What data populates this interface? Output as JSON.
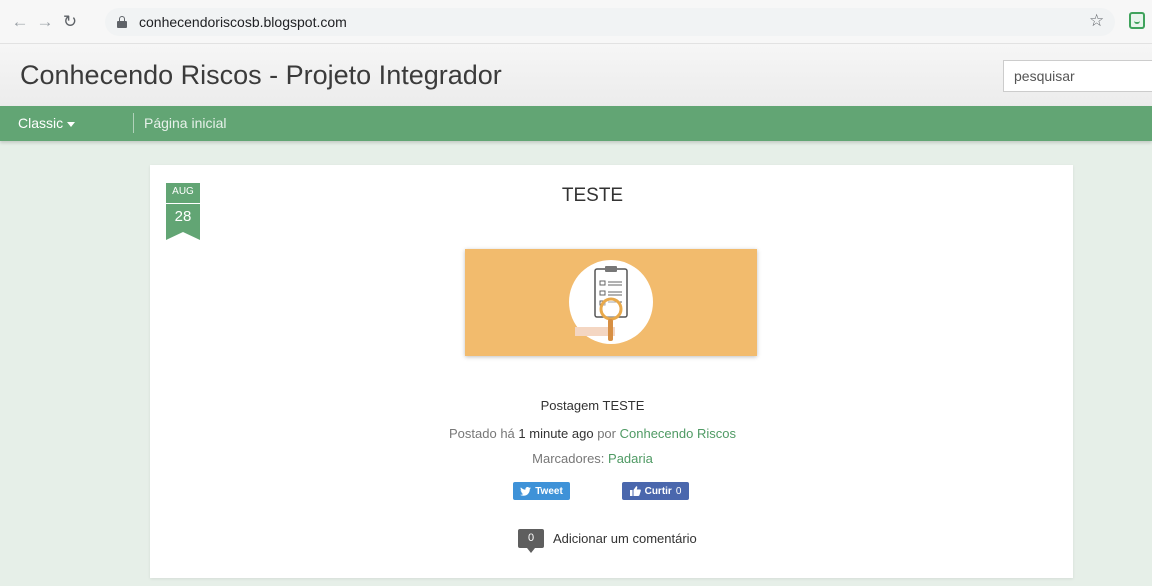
{
  "browser": {
    "url": "conhecendoriscosb.blogspot.com",
    "icons": {
      "back": "arrow-left-icon",
      "forward": "arrow-right-icon",
      "reload": "reload-icon",
      "lock": "lock-icon",
      "bookmark": "star-icon",
      "extension": "extension-icon"
    }
  },
  "header": {
    "title": "Conhecendo Riscos - Projeto Integrador",
    "search_placeholder": "pesquisar"
  },
  "nav": {
    "view_label": "Classic",
    "home_label": "Página inicial",
    "bar_color": "#62a574"
  },
  "post": {
    "date_month": "AUG",
    "date_day": "28",
    "title": "TESTE",
    "image_description_icon": "clipboard-magnifier-illustration",
    "body": "Postagem TESTE",
    "meta_prefix": "Postado há",
    "meta_time": "1 minute ago",
    "meta_by": "por",
    "author": "Conhecendo Riscos",
    "labels_prefix": "Marcadores:",
    "label": "Padaria",
    "tweet_label": "Tweet",
    "like_label": "Curtir",
    "like_count": "0",
    "comment_count": "0",
    "comment_label": "Adicionar um comentário"
  },
  "colors": {
    "accent": "#62a574",
    "link": "#4f9a64",
    "image_bg": "#f2bb6d",
    "tweet": "#3e92d8",
    "like": "#4a67ad"
  }
}
